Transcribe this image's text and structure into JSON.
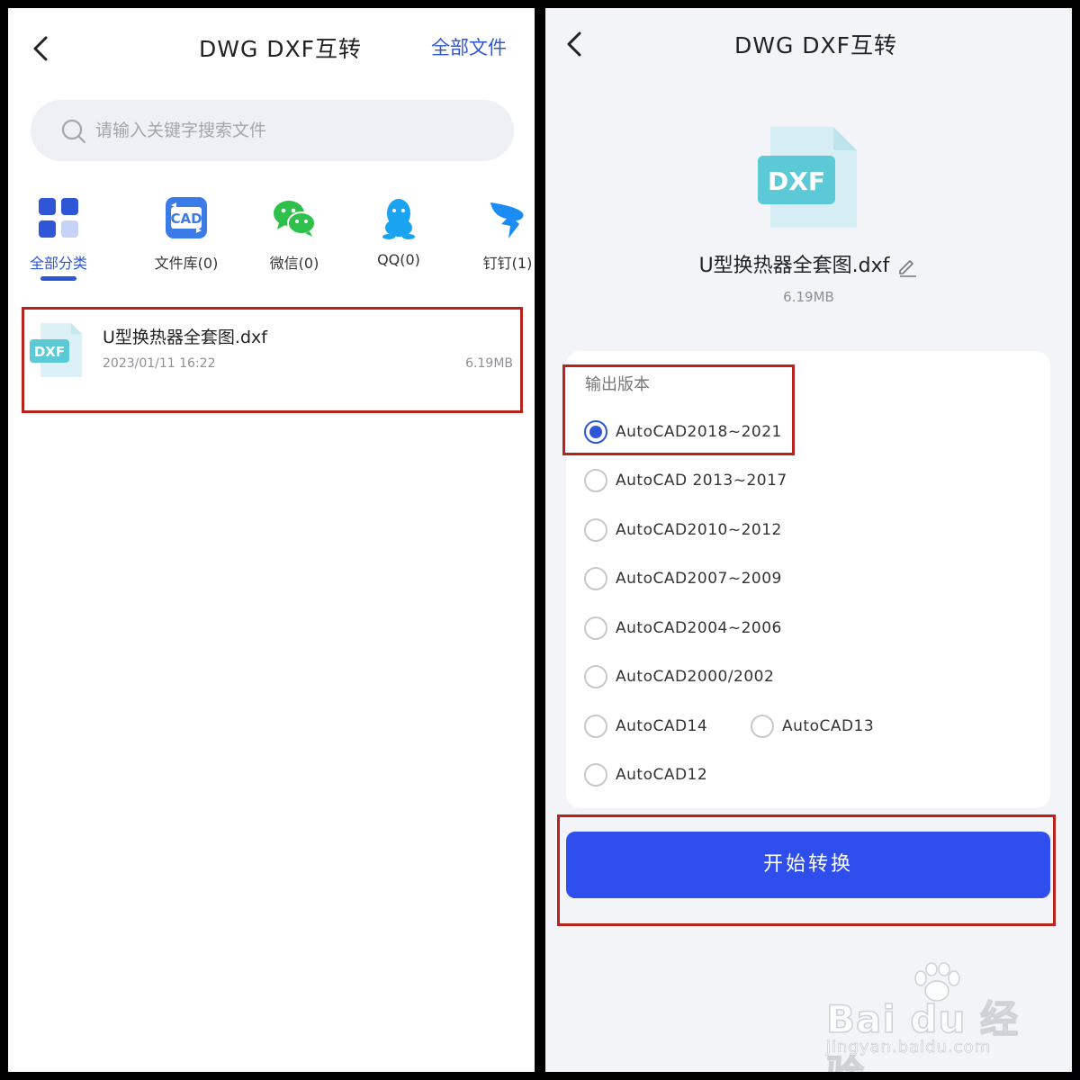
{
  "left": {
    "header": {
      "title": "DWG DXF互转",
      "right_link": "全部文件"
    },
    "search": {
      "placeholder": "请输入关键字搜索文件"
    },
    "categories": [
      {
        "label": "全部分类",
        "icon": "grid-icon",
        "active": true
      },
      {
        "label": "文件库(0)",
        "icon": "cad-icon"
      },
      {
        "label": "微信(0)",
        "icon": "wechat-icon"
      },
      {
        "label": "QQ(0)",
        "icon": "qq-icon"
      },
      {
        "label": "钉钉(1)",
        "icon": "dingtalk-icon"
      }
    ],
    "files": [
      {
        "badge": "DXF",
        "name": "U型换热器全套图.dxf",
        "date": "2023/01/11 16:22",
        "size": "6.19MB"
      }
    ]
  },
  "right": {
    "header": {
      "title": "DWG DXF互转"
    },
    "file": {
      "badge": "DXF",
      "name": "U型换热器全套图.dxf",
      "size": "6.19MB"
    },
    "section_label": "输出版本",
    "options": [
      {
        "label": "AutoCAD2018~2021",
        "selected": true
      },
      {
        "label": "AutoCAD 2013~2017"
      },
      {
        "label": "AutoCAD2010~2012"
      },
      {
        "label": "AutoCAD2007~2009"
      },
      {
        "label": "AutoCAD2004~2006"
      },
      {
        "label": "AutoCAD2000/2002"
      },
      {
        "label": "AutoCAD14"
      },
      {
        "label": "AutoCAD13"
      },
      {
        "label": "AutoCAD12"
      }
    ],
    "button_label": "开始转换"
  },
  "watermark": {
    "brand": "Bai du 经验",
    "url": "jingyan.baidu.com"
  },
  "colors": {
    "accent": "#2f56d6",
    "button": "#2e4eee",
    "highlight": "#b8221c",
    "dxf": "#5cc9d6"
  }
}
